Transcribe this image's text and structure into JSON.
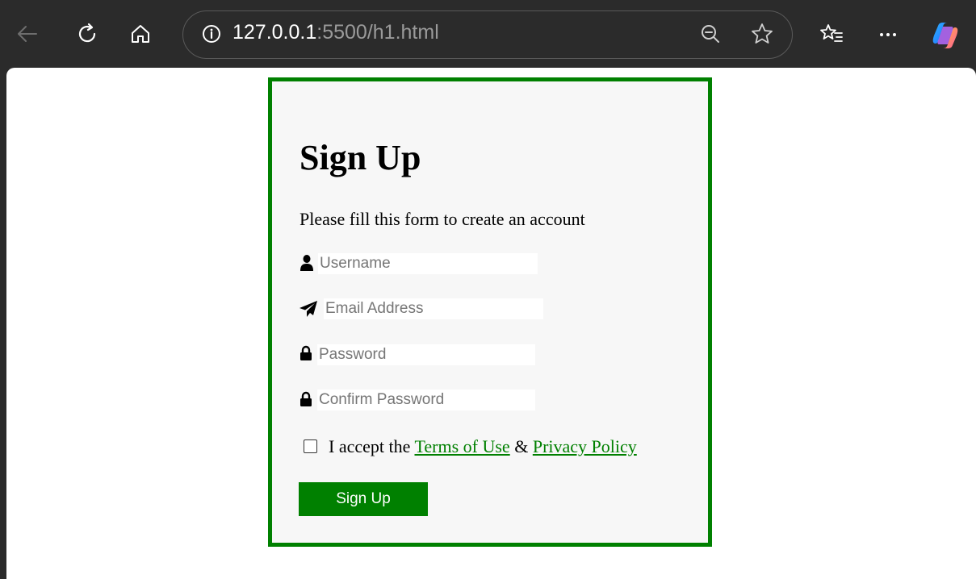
{
  "browser": {
    "url_host": "127.0.0.1",
    "url_rest": ":5500/h1.html"
  },
  "form": {
    "title": "Sign Up",
    "subtitle": "Please fill this form to create an account",
    "fields": [
      {
        "icon": "user-icon",
        "placeholder": "Username",
        "value": ""
      },
      {
        "icon": "paper-plane-icon",
        "placeholder": "Email Address",
        "value": ""
      },
      {
        "icon": "lock-icon",
        "placeholder": "Password",
        "value": ""
      },
      {
        "icon": "lock-icon",
        "placeholder": "Confirm Password",
        "value": ""
      }
    ],
    "accept": {
      "prefix": "I accept the",
      "terms_link": "Terms of Use",
      "separator": "&",
      "privacy_link": "Privacy Policy",
      "checked": false
    },
    "submit_label": "Sign Up"
  },
  "colors": {
    "accent": "#008000",
    "card_background": "#f7f7f7",
    "chrome_background": "#2b2b2b"
  }
}
